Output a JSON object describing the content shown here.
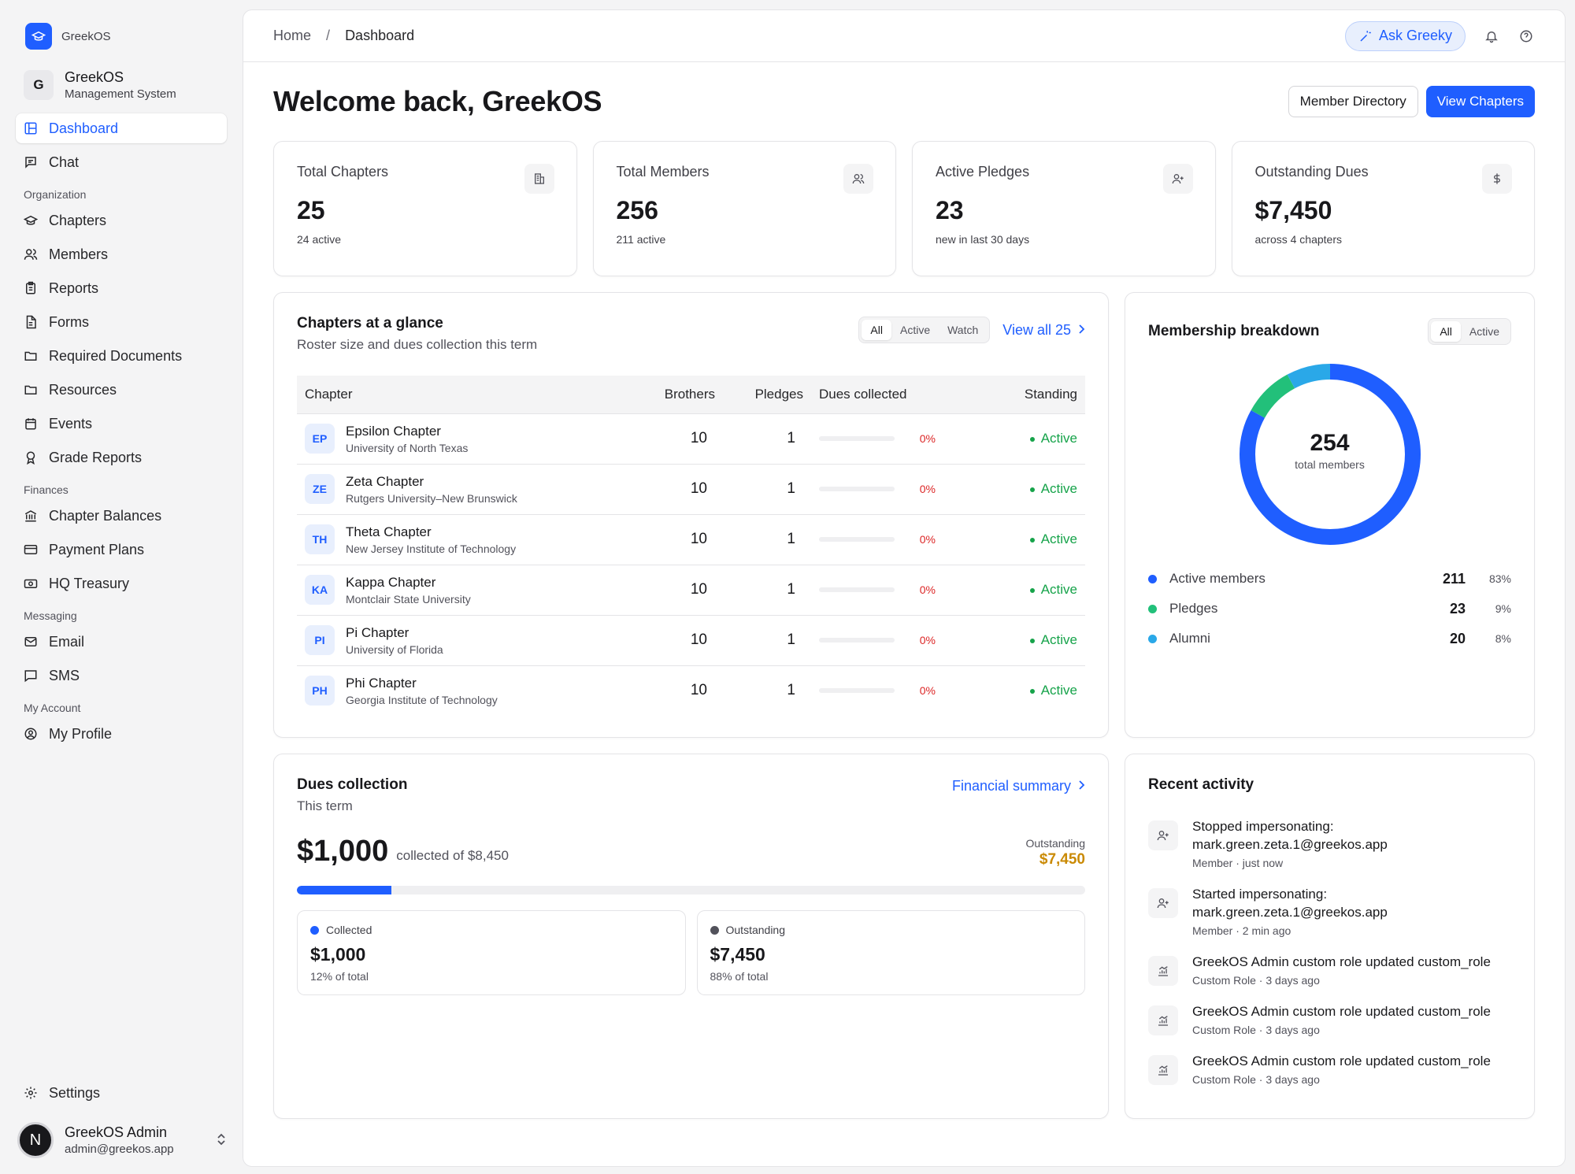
{
  "brand": {
    "name": "GreekOS"
  },
  "org": {
    "initial": "G",
    "name": "GreekOS",
    "subtitle": "Management System"
  },
  "nav": {
    "dashboard": "Dashboard",
    "chat": "Chat",
    "section_org": "Organization",
    "chapters": "Chapters",
    "members": "Members",
    "reports": "Reports",
    "forms": "Forms",
    "required_documents": "Required Documents",
    "resources": "Resources",
    "events": "Events",
    "grade_reports": "Grade Reports",
    "section_finances": "Finances",
    "chapter_balances": "Chapter Balances",
    "payment_plans": "Payment Plans",
    "hq_treasury": "HQ Treasury",
    "section_messaging": "Messaging",
    "email": "Email",
    "sms": "SMS",
    "section_account": "My Account",
    "my_profile": "My Profile",
    "settings": "Settings"
  },
  "user": {
    "initial": "N",
    "name": "GreekOS Admin",
    "email": "admin@greekos.app"
  },
  "topbar": {
    "crumb_home": "Home",
    "crumb_sep": "/",
    "crumb_current": "Dashboard",
    "ask_label": "Ask Greeky"
  },
  "header": {
    "title": "Welcome back, GreekOS",
    "member_directory": "Member Directory",
    "view_chapters": "View Chapters"
  },
  "stats": [
    {
      "label": "Total Chapters",
      "value": "25",
      "sub": "24 active",
      "icon": "building-icon"
    },
    {
      "label": "Total Members",
      "value": "256",
      "sub": "211 active",
      "icon": "users-icon"
    },
    {
      "label": "Active Pledges",
      "value": "23",
      "sub": "new in last 30 days",
      "icon": "user-plus-icon"
    },
    {
      "label": "Outstanding Dues",
      "value": "$7,450",
      "sub": "across 4 chapters",
      "icon": "dollar-icon"
    }
  ],
  "chapters_card": {
    "title": "Chapters at a glance",
    "subtitle": "Roster size and dues collection this term",
    "filters": [
      "All",
      "Active",
      "Watch"
    ],
    "view_all": "View all 25",
    "columns": [
      "Chapter",
      "Brothers",
      "Pledges",
      "Dues collected",
      "Standing"
    ],
    "rows": [
      {
        "abbr": "EP",
        "name": "Epsilon Chapter",
        "school": "University of North Texas",
        "brothers": "10",
        "pledges": "1",
        "dues_pct": "0%",
        "dues_fraction": 0,
        "standing": "Active"
      },
      {
        "abbr": "ZE",
        "name": "Zeta Chapter",
        "school": "Rutgers University–New Brunswick",
        "brothers": "10",
        "pledges": "1",
        "dues_pct": "0%",
        "dues_fraction": 0,
        "standing": "Active"
      },
      {
        "abbr": "TH",
        "name": "Theta Chapter",
        "school": "New Jersey Institute of Technology",
        "brothers": "10",
        "pledges": "1",
        "dues_pct": "0%",
        "dues_fraction": 0,
        "standing": "Active"
      },
      {
        "abbr": "KA",
        "name": "Kappa Chapter",
        "school": "Montclair State University",
        "brothers": "10",
        "pledges": "1",
        "dues_pct": "0%",
        "dues_fraction": 0,
        "standing": "Active"
      },
      {
        "abbr": "PI",
        "name": "Pi Chapter",
        "school": "University of Florida",
        "brothers": "10",
        "pledges": "1",
        "dues_pct": "0%",
        "dues_fraction": 0,
        "standing": "Active"
      },
      {
        "abbr": "PH",
        "name": "Phi Chapter",
        "school": "Georgia Institute of Technology",
        "brothers": "10",
        "pledges": "1",
        "dues_pct": "0%",
        "dues_fraction": 0,
        "standing": "Active"
      }
    ]
  },
  "membership": {
    "title": "Membership breakdown",
    "filters": [
      "All",
      "Active"
    ],
    "total": "254",
    "total_label": "total members",
    "segments": [
      {
        "name": "Active members",
        "value": "211",
        "pct": "83%",
        "color": "#1f5eff"
      },
      {
        "name": "Pledges",
        "value": "23",
        "pct": "9%",
        "color": "#22c07a"
      },
      {
        "name": "Alumni",
        "value": "20",
        "pct": "8%",
        "color": "#2aa8e8"
      }
    ]
  },
  "dues": {
    "title": "Dues collection",
    "subtitle": "This term",
    "link": "Financial summary",
    "collected_amount": "$1,000",
    "collected_of": "collected of $8,450",
    "outstanding_label": "Outstanding",
    "outstanding_amount": "$7,450",
    "progress_fraction": 0.12,
    "boxes": [
      {
        "label": "Collected",
        "value": "$1,000",
        "sub": "12% of total",
        "color": "#1f5eff"
      },
      {
        "label": "Outstanding",
        "value": "$7,450",
        "sub": "88% of total",
        "color": "#52525b"
      }
    ]
  },
  "activity": {
    "title": "Recent activity",
    "items": [
      {
        "icon": "user-plus-icon",
        "title": "Stopped impersonating: mark.green.zeta.1@greekos.app",
        "meta": "Member · just now"
      },
      {
        "icon": "user-plus-icon",
        "title": "Started impersonating: mark.green.zeta.1@greekos.app",
        "meta": "Member · 2 min ago"
      },
      {
        "icon": "chart-icon",
        "title": "GreekOS Admin custom role updated custom_role",
        "meta": "Custom Role · 3 days ago"
      },
      {
        "icon": "chart-icon",
        "title": "GreekOS Admin custom role updated custom_role",
        "meta": "Custom Role · 3 days ago"
      },
      {
        "icon": "chart-icon",
        "title": "GreekOS Admin custom role updated custom_role",
        "meta": "Custom Role · 3 days ago"
      }
    ]
  },
  "colors": {
    "accent": "#1f5eff",
    "success": "#16a34a",
    "danger": "#dc2626",
    "warning": "#ca8a04"
  }
}
